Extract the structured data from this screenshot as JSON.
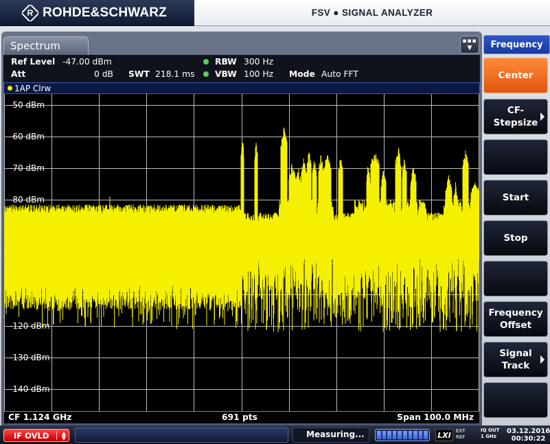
{
  "header": {
    "brand": "ROHDE&SCHWARZ",
    "title": "FSV ● SIGNAL ANALYZER"
  },
  "window": {
    "tab": "Spectrum",
    "ref_level_label": "Ref Level",
    "ref_level_value": "-47.00 dBm",
    "att_label": "Att",
    "att_value": "0 dB",
    "swt_label": "SWT",
    "swt_value": "218.1 ms",
    "rbw_label": "RBW",
    "rbw_value": "300 Hz",
    "vbw_label": "VBW",
    "vbw_value": "100 Hz",
    "mode_label": "Mode",
    "mode_value": "Auto FFT",
    "trace_label": "1AP Clrw"
  },
  "plot": {
    "trace_color": "#f5f000",
    "background": "#000000",
    "y_ticks": [
      "-50 dBm",
      "-60 dBm",
      "-70 dBm",
      "-80 dBm",
      "",
      "",
      "",
      "-120 dBm",
      "-130 dBm",
      "-140 dBm"
    ],
    "cf": "CF 1.124 GHz",
    "pts": "691 pts",
    "span": "Span 100.0 MHz"
  },
  "softkeys": {
    "header": "Frequency",
    "items": [
      {
        "label": "Center",
        "active": true,
        "arrow": false
      },
      {
        "label": "CF-\nStepsize",
        "active": false,
        "arrow": true
      },
      {
        "label": "",
        "active": false,
        "arrow": false
      },
      {
        "label": "Start",
        "active": false,
        "arrow": false
      },
      {
        "label": "Stop",
        "active": false,
        "arrow": false
      },
      {
        "label": "",
        "active": false,
        "arrow": false
      },
      {
        "label": "Frequency\nOffset",
        "active": false,
        "arrow": false
      },
      {
        "label": "Signal\nTrack",
        "active": false,
        "arrow": true
      },
      {
        "label": "",
        "active": false,
        "arrow": false
      }
    ]
  },
  "status": {
    "ifovld": "IF OVLD",
    "measuring": "Measuring...",
    "lxi": "LXI",
    "ext_ref": "EXT\nREF",
    "iq_out": "IQ OUT\n1 GHz",
    "date": "03.12.2016",
    "time": "00:30:22"
  }
}
